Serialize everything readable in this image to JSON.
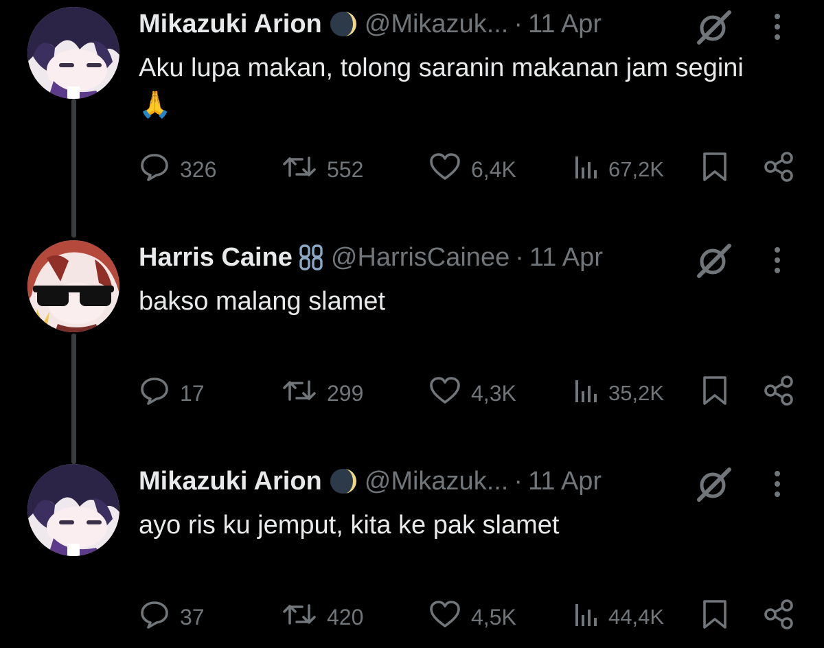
{
  "tweets": [
    {
      "author_name": "Mikazuki Arion",
      "badge_icon": "crescent-moon-icon",
      "handle": "@Mikazuk...",
      "separator": "·",
      "date": "11 Apr",
      "text": "Aku lupa makan, tolong saranin makanan jam segini 🙏",
      "stats": {
        "replies": "326",
        "reposts": "552",
        "likes": "6,4K",
        "views": "67,2K"
      }
    },
    {
      "author_name": "Harris Caine",
      "badge_icon": "chain-link-icon",
      "handle": "@HarrisCainee",
      "separator": "·",
      "date": "11 Apr",
      "text": "bakso malang slamet",
      "stats": {
        "replies": "17",
        "reposts": "299",
        "likes": "4,3K",
        "views": "35,2K"
      }
    },
    {
      "author_name": "Mikazuki Arion",
      "badge_icon": "crescent-moon-icon",
      "handle": "@Mikazuk...",
      "separator": "·",
      "date": "11 Apr",
      "text": "ayo ris ku jemput, kita ke pak slamet",
      "stats": {
        "replies": "37",
        "reposts": "420",
        "likes": "4,5K",
        "views": "44,4K"
      }
    }
  ],
  "icons": {
    "reply": "speech-bubble-icon",
    "repost": "repost-arrows-icon",
    "like": "heart-icon",
    "views": "bar-chart-icon",
    "bookmark": "bookmark-icon",
    "share": "share-icon",
    "grok": "grok-icon",
    "more": "more-vertical-icon"
  },
  "colors": {
    "background": "#000000",
    "primary_text": "#e7e9ea",
    "secondary_text": "#71767b",
    "thread_line": "#3a3d40",
    "chain_badge": "#8aa8c6"
  }
}
